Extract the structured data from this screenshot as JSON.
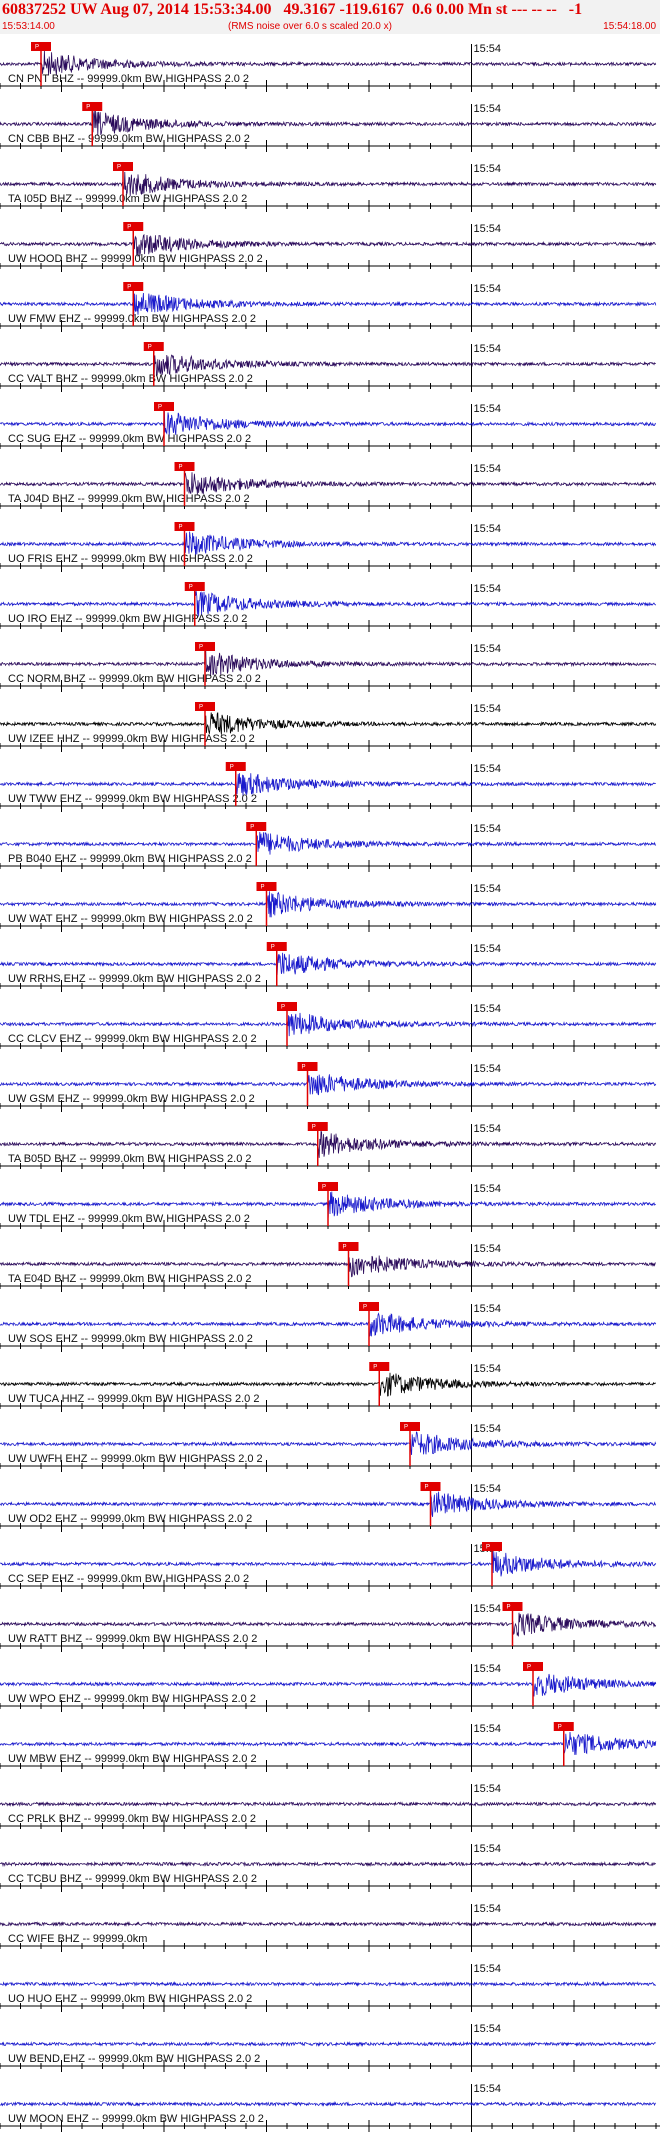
{
  "header": {
    "title": "60837252 UW Aug 07, 2014 15:53:34.00   49.3167 -119.6167  0.6 0.00 Mn st --- -- --   -1",
    "start_time": "15:53:14.00",
    "subtitle": "(RMS noise over 6.0 s scaled 20.0 x)",
    "end_time": "15:54:18.00"
  },
  "colors": {
    "accent": "#e00000",
    "trace_blue": "#1a1acc",
    "trace_purple": "#2a0a5a",
    "trace_black": "#000000",
    "pick": "#e00000"
  },
  "chart_data": {
    "type": "seismogram",
    "title": "60837252 UW Aug 07, 2014 15:53:34.00   49.3167 -119.6167  0.6 0.00 Mn st --- -- --   -1",
    "x_range": [
      "15:53:14.00",
      "15:54:18.00"
    ],
    "tick_label": "15:54",
    "pick_label": "P",
    "series": [
      {
        "name": "CN PNT BHZ -- 99999.0km BW  HIGHPASS  2.0  2",
        "color": "#2a0a5a",
        "pick_s": 4
      },
      {
        "name": "CN CBB BHZ -- 99999.0km BW  HIGHPASS  2.0  2",
        "color": "#2a0a5a",
        "pick_s": 9
      },
      {
        "name": "TA I05D BHZ -- 99999.0km BW  HIGHPASS  2.0  2",
        "color": "#2a0a5a",
        "pick_s": 12
      },
      {
        "name": "UW HOOD BHZ -- 99999.0km BW  HIGHPASS  2.0  2",
        "color": "#2a0a5a",
        "pick_s": 13
      },
      {
        "name": "UW FMW EHZ -- 99999.0km BW  HIGHPASS  2.0  2",
        "color": "#1a1acc",
        "pick_s": 13
      },
      {
        "name": "CC VALT BHZ -- 99999.0km BW  HIGHPASS  2.0  2",
        "color": "#2a0a5a",
        "pick_s": 15
      },
      {
        "name": "CC SUG EHZ -- 99999.0km BW  HIGHPASS  2.0  2",
        "color": "#1a1acc",
        "pick_s": 16
      },
      {
        "name": "TA J04D BHZ -- 99999.0km BW  HIGHPASS  2.0  2",
        "color": "#2a0a5a",
        "pick_s": 18
      },
      {
        "name": "UO FRIS EHZ -- 99999.0km BW  HIGHPASS  2.0  2",
        "color": "#1a1acc",
        "pick_s": 18
      },
      {
        "name": "UO IRO EHZ -- 99999.0km BW  HIGHPASS  2.0  2",
        "color": "#1a1acc",
        "pick_s": 19
      },
      {
        "name": "CC NORM BHZ -- 99999.0km BW  HIGHPASS  2.0  2",
        "color": "#2a0a5a",
        "pick_s": 20
      },
      {
        "name": "UW IZEE HHZ -- 99999.0km BW  HIGHPASS  2.0  2",
        "color": "#000000",
        "pick_s": 20
      },
      {
        "name": "UW TWW EHZ -- 99999.0km BW  HIGHPASS  2.0  2",
        "color": "#1a1acc",
        "pick_s": 23
      },
      {
        "name": "PB B040 EHZ -- 99999.0km BW  HIGHPASS  2.0  2",
        "color": "#1a1acc",
        "pick_s": 25
      },
      {
        "name": "UW WAT EHZ -- 99999.0km BW  HIGHPASS  2.0  2",
        "color": "#1a1acc",
        "pick_s": 26
      },
      {
        "name": "UW RRHS EHZ -- 99999.0km BW  HIGHPASS  2.0  2",
        "color": "#1a1acc",
        "pick_s": 27
      },
      {
        "name": "CC CLCV EHZ -- 99999.0km BW  HIGHPASS  2.0  2",
        "color": "#1a1acc",
        "pick_s": 28
      },
      {
        "name": "UW GSM EHZ -- 99999.0km BW  HIGHPASS  2.0  2",
        "color": "#1a1acc",
        "pick_s": 30
      },
      {
        "name": "TA B05D BHZ -- 99999.0km BW  HIGHPASS  2.0  2",
        "color": "#2a0a5a",
        "pick_s": 31
      },
      {
        "name": "UW TDL EHZ -- 99999.0km BW  HIGHPASS  2.0  2",
        "color": "#1a1acc",
        "pick_s": 32
      },
      {
        "name": "TA E04D BHZ -- 99999.0km BW  HIGHPASS  2.0  2",
        "color": "#2a0a5a",
        "pick_s": 34
      },
      {
        "name": "UW SOS EHZ -- 99999.0km BW  HIGHPASS  2.0  2",
        "color": "#1a1acc",
        "pick_s": 36
      },
      {
        "name": "UW TUCA HHZ -- 99999.0km BW  HIGHPASS  2.0  2",
        "color": "#000000",
        "pick_s": 37
      },
      {
        "name": "UW UWFH EHZ -- 99999.0km BW  HIGHPASS  2.0  2",
        "color": "#1a1acc",
        "pick_s": 40
      },
      {
        "name": "UW OD2 EHZ -- 99999.0km BW  HIGHPASS  2.0  2",
        "color": "#1a1acc",
        "pick_s": 42
      },
      {
        "name": "CC SEP EHZ -- 99999.0km BW  HIGHPASS  2.0  2",
        "color": "#1a1acc",
        "pick_s": 48
      },
      {
        "name": "UW RATT BHZ -- 99999.0km BW  HIGHPASS  2.0  2",
        "color": "#2a0a5a",
        "pick_s": 50
      },
      {
        "name": "UW WPO EHZ -- 99999.0km BW  HIGHPASS  2.0  2",
        "color": "#1a1acc",
        "pick_s": 52
      },
      {
        "name": "UW MBW EHZ -- 99999.0km BW  HIGHPASS  2.0  2",
        "color": "#1a1acc",
        "pick_s": 55
      },
      {
        "name": "CC PRLK BHZ -- 99999.0km BW  HIGHPASS  2.0  2",
        "color": "#2a0a5a",
        "pick_s": null
      },
      {
        "name": "CC TCBU BHZ -- 99999.0km BW  HIGHPASS  2.0  2",
        "color": "#2a0a5a",
        "pick_s": null
      },
      {
        "name": "CC WIFE BHZ -- 99999.0km",
        "color": "#2a0a5a",
        "pick_s": null
      },
      {
        "name": "UO HUO EHZ -- 99999.0km BW  HIGHPASS  2.0  2",
        "color": "#1a1acc",
        "pick_s": null
      },
      {
        "name": "UW BEND EHZ -- 99999.0km BW  HIGHPASS  2.0  2",
        "color": "#1a1acc",
        "pick_s": null
      },
      {
        "name": "UW MOON EHZ -- 99999.0km BW  HIGHPASS  2.0  2",
        "color": "#1a1acc",
        "pick_s": null
      }
    ]
  }
}
